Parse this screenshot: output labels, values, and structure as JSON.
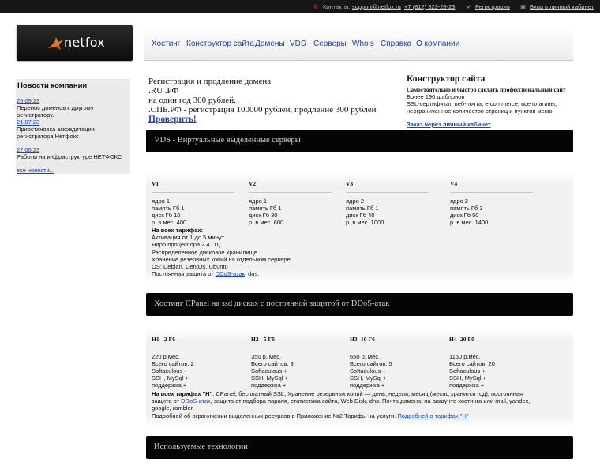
{
  "topbar": {
    "contacts_label": "Контакты:",
    "email": "support@netfox.ru",
    "phone": "+7 (812) 323-23-23",
    "register": "Регистрация",
    "login": "Вход в личный кабинет"
  },
  "logo": {
    "text": "netfox"
  },
  "nav": [
    "Хостинг",
    "Конструктор сайта",
    "Домены",
    "VDS",
    "Серверы",
    "Whois",
    "Справка",
    "О компании"
  ],
  "news": {
    "title": "Новости компании",
    "items": [
      {
        "date": "25.09.23",
        "text": "Перенос доменов к другому регистратору."
      },
      {
        "date": "21.07.23",
        "text": "Приостановка аккредитации регистратора Нетфокс"
      },
      {
        "date": "27.06.23",
        "text": "Работы на инфраструктуре НЕТФОКС"
      }
    ],
    "all": "все новости..."
  },
  "domain_promo": {
    "line1": "Регистрация и продление домена",
    "line2": ".RU .РФ",
    "line3": "на один год 300 рублей.",
    "line4": ".СПБ.РФ - регистрация 100000 рублей, продление 300 рублей",
    "check": "Проверить!"
  },
  "builder_promo": {
    "title": "Конструктор сайта",
    "subtitle": "Самостоятельно и быстро сделать профессиональный сайт",
    "lines": [
      "Более 190 шаблонов",
      "SSL-сертификат, веб-почта, e-commerce, все плагины,",
      "неограниченное количество страниц и пунктов меню"
    ],
    "link": "Заказ через личный кабинет"
  },
  "vds": {
    "bar": "VDS - Виртуальные выделенные серверы",
    "plans": [
      {
        "name": "V1",
        "lines": [
          "ядро 1",
          "память Гб 1",
          "диск  Гб 10",
          "р. в мес. 400"
        ]
      },
      {
        "name": "V2",
        "lines": [
          "ядро 1",
          "память Гб 1",
          "диск  Гб 30",
          "р. в мес. 600"
        ]
      },
      {
        "name": "V3",
        "lines": [
          "ядро 2",
          "память Гб 1",
          "диск  Гб 40",
          "р. в мес. 1000"
        ]
      },
      {
        "name": "V4",
        "lines": [
          "ядро 2",
          "память Гб 3",
          "диск  Гб 50",
          "р. в мес. 1400"
        ]
      }
    ],
    "all_title": "На всех тарифах:",
    "features": [
      "Активация от 1 до 5 минут",
      "Ядро процессора 2.4 Ггц",
      "Распределенное дисковое хранилище",
      "Хранение резервных копий на отдельном сервере",
      "OS: Debian, CentOs, Ubuntu"
    ],
    "protection_prefix": "Постоянная защита от ",
    "protection_link": "DDoS-атак",
    "protection_suffix": ", dns."
  },
  "hosting": {
    "bar": "Хостинг CPanel на ssd дисках с постоянной защитой от DDoS-атак",
    "plans": [
      {
        "name": "H1 - 2 Гб",
        "lines": [
          "220 р.мес.",
          "Всего сайтов: 2",
          "Softaculous +",
          "SSH, MySql +",
          "поддержка +"
        ]
      },
      {
        "name": "H2 - 5 Гб",
        "lines": [
          "350 р. мес.",
          "Всего сайтов: 3",
          "Softaculous +",
          "SSH, MySql +",
          "поддержка +"
        ]
      },
      {
        "name": "H3 -10 Гб",
        "lines": [
          "650 р. мес.",
          "Всего сайтов: 5",
          "Softaculous +",
          "SSH, MySql +",
          "поддержка +"
        ]
      },
      {
        "name": "H4 -20 Гб",
        "lines": [
          "1150 р.мес.",
          "Всего сайтов: 20",
          "Softaculous +",
          "SSH, MySql +",
          "поддержка +"
        ]
      }
    ],
    "all_bold": "На всех тарифах \"Н\"",
    "all_line1": ": CPanel, бесплатный SSL, Хранение резервных копий — день, неделя, месяц (месяц хранится год), постоянная",
    "all_line2_prefix": "защита от ",
    "all_line2_link": "DDoS-атак",
    "all_line2_suffix": ", защита от подбора пароля, статистика сайта, Web Disk, dns. Почта домена: на аккаунте хостинга или mail, yandex,",
    "all_line3": "google, rambler.",
    "all_line4_prefix": "Подробней об ограничении выделенных ресурсов в Приложение №2 Тарифы на услуги. ",
    "all_line4_link": "Подробней о тарифах \"Н\""
  },
  "tech": {
    "bar": "Используемые технологии"
  }
}
